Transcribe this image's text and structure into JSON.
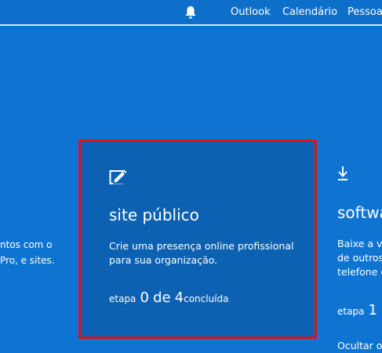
{
  "header": {
    "notification_icon": "bell-icon",
    "nav": [
      {
        "label": "Outlook"
      },
      {
        "label": "Calendário"
      },
      {
        "label": "Pessoas"
      }
    ]
  },
  "left_card_fragment": {
    "lines": [
      "ntos com o",
      "Pro, e sites."
    ]
  },
  "main_card": {
    "icon": "edit-icon",
    "title": "site público",
    "description": "Crie uma presença online profissional para sua organização.",
    "step_prefix": "etapa",
    "step_current": "0",
    "step_of": "de",
    "step_total": "4",
    "step_suffix": "concluída",
    "highlight_color": "#e0121a"
  },
  "right_card_fragment": {
    "icon": "download-icon",
    "title": "softwa",
    "lines": [
      "Baixe a ve",
      "de outros",
      "telefone e"
    ],
    "step_prefix": "etapa",
    "step_current": "1",
    "hide_link": "Ocultar o"
  },
  "colors": {
    "background": "#0f74d1",
    "card": "#0c61b2",
    "text": "#ffffff"
  }
}
